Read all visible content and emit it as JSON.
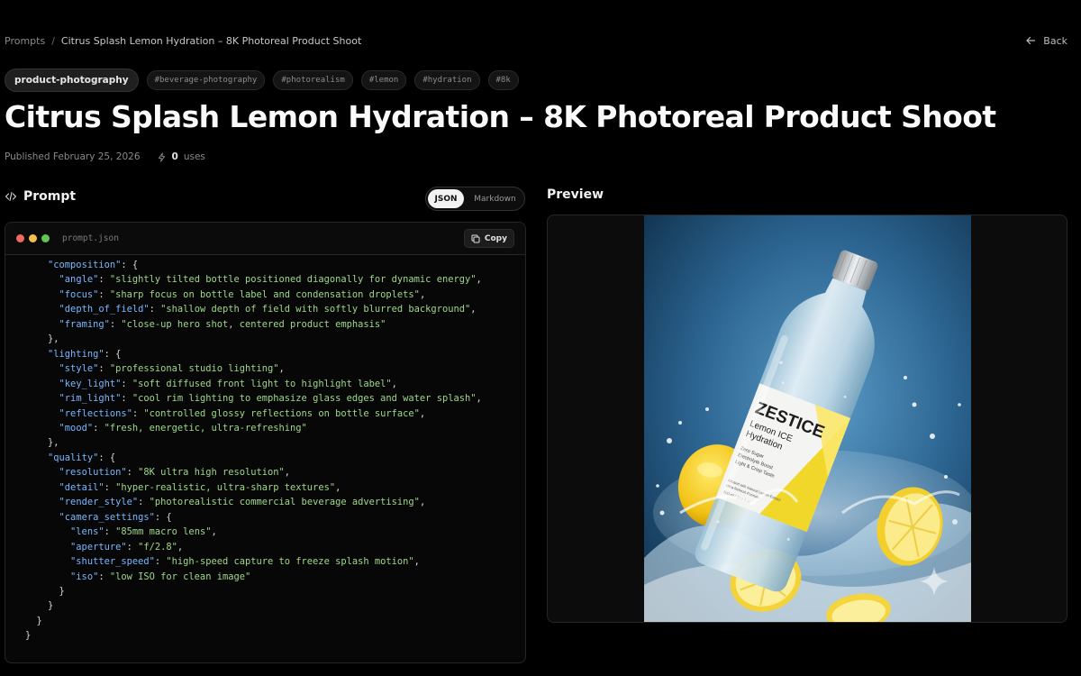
{
  "breadcrumb": {
    "root": "Prompts",
    "separator": "/",
    "current": "Citrus Splash Lemon Hydration – 8K Photoreal Product Shoot"
  },
  "nav": {
    "back_label": "Back"
  },
  "tags": [
    "product-photography",
    "#beverage-photography",
    "#photorealism",
    "#lemon",
    "#hydration",
    "#8k"
  ],
  "title": "Citrus Splash Lemon Hydration – 8K Photoreal Product Shoot",
  "meta": {
    "published": "Published February 25, 2026",
    "uses_count": "0",
    "uses_label": "uses"
  },
  "prompt": {
    "heading": "Prompt",
    "format_options": [
      "JSON",
      "Markdown"
    ],
    "selected_format": "JSON",
    "filename": "prompt.json",
    "copy_label": "Copy",
    "code_lines": [
      {
        "indent": 2,
        "key": "composition",
        "val": null,
        "tail": "{"
      },
      {
        "indent": 3,
        "key": "angle",
        "val": "slightly tilted bottle positioned diagonally for dynamic energy",
        "tail": ","
      },
      {
        "indent": 3,
        "key": "focus",
        "val": "sharp focus on bottle label and condensation droplets",
        "tail": ","
      },
      {
        "indent": 3,
        "key": "depth_of_field",
        "val": "shallow depth of field with softly blurred background",
        "tail": ","
      },
      {
        "indent": 3,
        "key": "framing",
        "val": "close-up hero shot, centered product emphasis",
        "tail": ""
      },
      {
        "indent": 2,
        "key": null,
        "val": null,
        "tail": "},"
      },
      {
        "indent": 2,
        "key": "lighting",
        "val": null,
        "tail": "{"
      },
      {
        "indent": 3,
        "key": "style",
        "val": "professional studio lighting",
        "tail": ","
      },
      {
        "indent": 3,
        "key": "key_light",
        "val": "soft diffused front light to highlight label",
        "tail": ","
      },
      {
        "indent": 3,
        "key": "rim_light",
        "val": "cool rim lighting to emphasize glass edges and water splash",
        "tail": ","
      },
      {
        "indent": 3,
        "key": "reflections",
        "val": "controlled glossy reflections on bottle surface",
        "tail": ","
      },
      {
        "indent": 3,
        "key": "mood",
        "val": "fresh, energetic, ultra-refreshing",
        "tail": ""
      },
      {
        "indent": 2,
        "key": null,
        "val": null,
        "tail": "},"
      },
      {
        "indent": 2,
        "key": "quality",
        "val": null,
        "tail": "{"
      },
      {
        "indent": 3,
        "key": "resolution",
        "val": "8K ultra high resolution",
        "tail": ","
      },
      {
        "indent": 3,
        "key": "detail",
        "val": "hyper-realistic, ultra-sharp textures",
        "tail": ","
      },
      {
        "indent": 3,
        "key": "render_style",
        "val": "photorealistic commercial beverage advertising",
        "tail": ","
      },
      {
        "indent": 3,
        "key": "camera_settings",
        "val": null,
        "tail": "{"
      },
      {
        "indent": 4,
        "key": "lens",
        "val": "85mm macro lens",
        "tail": ","
      },
      {
        "indent": 4,
        "key": "aperture",
        "val": "f/2.8",
        "tail": ","
      },
      {
        "indent": 4,
        "key": "shutter_speed",
        "val": "high-speed capture to freeze splash motion",
        "tail": ","
      },
      {
        "indent": 4,
        "key": "iso",
        "val": "low ISO for clean image",
        "tail": ""
      },
      {
        "indent": 3,
        "key": null,
        "val": null,
        "tail": "}"
      },
      {
        "indent": 2,
        "key": null,
        "val": null,
        "tail": "}"
      },
      {
        "indent": 1,
        "key": null,
        "val": null,
        "tail": "}"
      },
      {
        "indent": 0,
        "key": null,
        "val": null,
        "tail": "}"
      }
    ]
  },
  "preview": {
    "heading": "Preview",
    "image_text": {
      "brand": "ZESTICE",
      "product": "Lemon ICE",
      "product_line2": "Hydration",
      "claims": [
        "Zero Sugar",
        "Electrolyte Boost",
        "Light & Crisp Taste"
      ],
      "fine_print": [
        "Infused with Natural Lemon Extract",
        "Ultra Refresh Formula"
      ],
      "volume": "500 ml / 16.9 fl oz"
    }
  },
  "colors": {
    "page_bg": "#000000",
    "json_key": "#79b8ff",
    "json_string": "#9ed88a",
    "dot_red": "#ed6a5e",
    "dot_yellow": "#f5bf4f",
    "dot_green": "#61c554"
  }
}
